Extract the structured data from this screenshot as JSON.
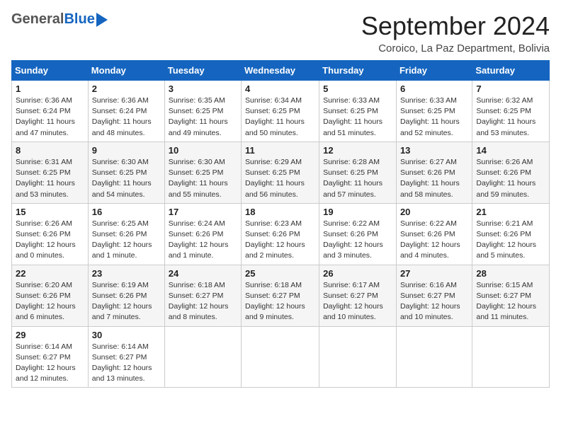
{
  "logo": {
    "general": "General",
    "blue": "Blue"
  },
  "title": "September 2024",
  "location": "Coroico, La Paz Department, Bolivia",
  "weekdays": [
    "Sunday",
    "Monday",
    "Tuesday",
    "Wednesday",
    "Thursday",
    "Friday",
    "Saturday"
  ],
  "weeks": [
    [
      {
        "day": "1",
        "info": "Sunrise: 6:36 AM\nSunset: 6:24 PM\nDaylight: 11 hours\nand 47 minutes."
      },
      {
        "day": "2",
        "info": "Sunrise: 6:36 AM\nSunset: 6:24 PM\nDaylight: 11 hours\nand 48 minutes."
      },
      {
        "day": "3",
        "info": "Sunrise: 6:35 AM\nSunset: 6:25 PM\nDaylight: 11 hours\nand 49 minutes."
      },
      {
        "day": "4",
        "info": "Sunrise: 6:34 AM\nSunset: 6:25 PM\nDaylight: 11 hours\nand 50 minutes."
      },
      {
        "day": "5",
        "info": "Sunrise: 6:33 AM\nSunset: 6:25 PM\nDaylight: 11 hours\nand 51 minutes."
      },
      {
        "day": "6",
        "info": "Sunrise: 6:33 AM\nSunset: 6:25 PM\nDaylight: 11 hours\nand 52 minutes."
      },
      {
        "day": "7",
        "info": "Sunrise: 6:32 AM\nSunset: 6:25 PM\nDaylight: 11 hours\nand 53 minutes."
      }
    ],
    [
      {
        "day": "8",
        "info": "Sunrise: 6:31 AM\nSunset: 6:25 PM\nDaylight: 11 hours\nand 53 minutes."
      },
      {
        "day": "9",
        "info": "Sunrise: 6:30 AM\nSunset: 6:25 PM\nDaylight: 11 hours\nand 54 minutes."
      },
      {
        "day": "10",
        "info": "Sunrise: 6:30 AM\nSunset: 6:25 PM\nDaylight: 11 hours\nand 55 minutes."
      },
      {
        "day": "11",
        "info": "Sunrise: 6:29 AM\nSunset: 6:25 PM\nDaylight: 11 hours\nand 56 minutes."
      },
      {
        "day": "12",
        "info": "Sunrise: 6:28 AM\nSunset: 6:25 PM\nDaylight: 11 hours\nand 57 minutes."
      },
      {
        "day": "13",
        "info": "Sunrise: 6:27 AM\nSunset: 6:26 PM\nDaylight: 11 hours\nand 58 minutes."
      },
      {
        "day": "14",
        "info": "Sunrise: 6:26 AM\nSunset: 6:26 PM\nDaylight: 11 hours\nand 59 minutes."
      }
    ],
    [
      {
        "day": "15",
        "info": "Sunrise: 6:26 AM\nSunset: 6:26 PM\nDaylight: 12 hours\nand 0 minutes."
      },
      {
        "day": "16",
        "info": "Sunrise: 6:25 AM\nSunset: 6:26 PM\nDaylight: 12 hours\nand 1 minute."
      },
      {
        "day": "17",
        "info": "Sunrise: 6:24 AM\nSunset: 6:26 PM\nDaylight: 12 hours\nand 1 minute."
      },
      {
        "day": "18",
        "info": "Sunrise: 6:23 AM\nSunset: 6:26 PM\nDaylight: 12 hours\nand 2 minutes."
      },
      {
        "day": "19",
        "info": "Sunrise: 6:22 AM\nSunset: 6:26 PM\nDaylight: 12 hours\nand 3 minutes."
      },
      {
        "day": "20",
        "info": "Sunrise: 6:22 AM\nSunset: 6:26 PM\nDaylight: 12 hours\nand 4 minutes."
      },
      {
        "day": "21",
        "info": "Sunrise: 6:21 AM\nSunset: 6:26 PM\nDaylight: 12 hours\nand 5 minutes."
      }
    ],
    [
      {
        "day": "22",
        "info": "Sunrise: 6:20 AM\nSunset: 6:26 PM\nDaylight: 12 hours\nand 6 minutes."
      },
      {
        "day": "23",
        "info": "Sunrise: 6:19 AM\nSunset: 6:26 PM\nDaylight: 12 hours\nand 7 minutes."
      },
      {
        "day": "24",
        "info": "Sunrise: 6:18 AM\nSunset: 6:27 PM\nDaylight: 12 hours\nand 8 minutes."
      },
      {
        "day": "25",
        "info": "Sunrise: 6:18 AM\nSunset: 6:27 PM\nDaylight: 12 hours\nand 9 minutes."
      },
      {
        "day": "26",
        "info": "Sunrise: 6:17 AM\nSunset: 6:27 PM\nDaylight: 12 hours\nand 10 minutes."
      },
      {
        "day": "27",
        "info": "Sunrise: 6:16 AM\nSunset: 6:27 PM\nDaylight: 12 hours\nand 10 minutes."
      },
      {
        "day": "28",
        "info": "Sunrise: 6:15 AM\nSunset: 6:27 PM\nDaylight: 12 hours\nand 11 minutes."
      }
    ],
    [
      {
        "day": "29",
        "info": "Sunrise: 6:14 AM\nSunset: 6:27 PM\nDaylight: 12 hours\nand 12 minutes."
      },
      {
        "day": "30",
        "info": "Sunrise: 6:14 AM\nSunset: 6:27 PM\nDaylight: 12 hours\nand 13 minutes."
      },
      null,
      null,
      null,
      null,
      null
    ]
  ]
}
